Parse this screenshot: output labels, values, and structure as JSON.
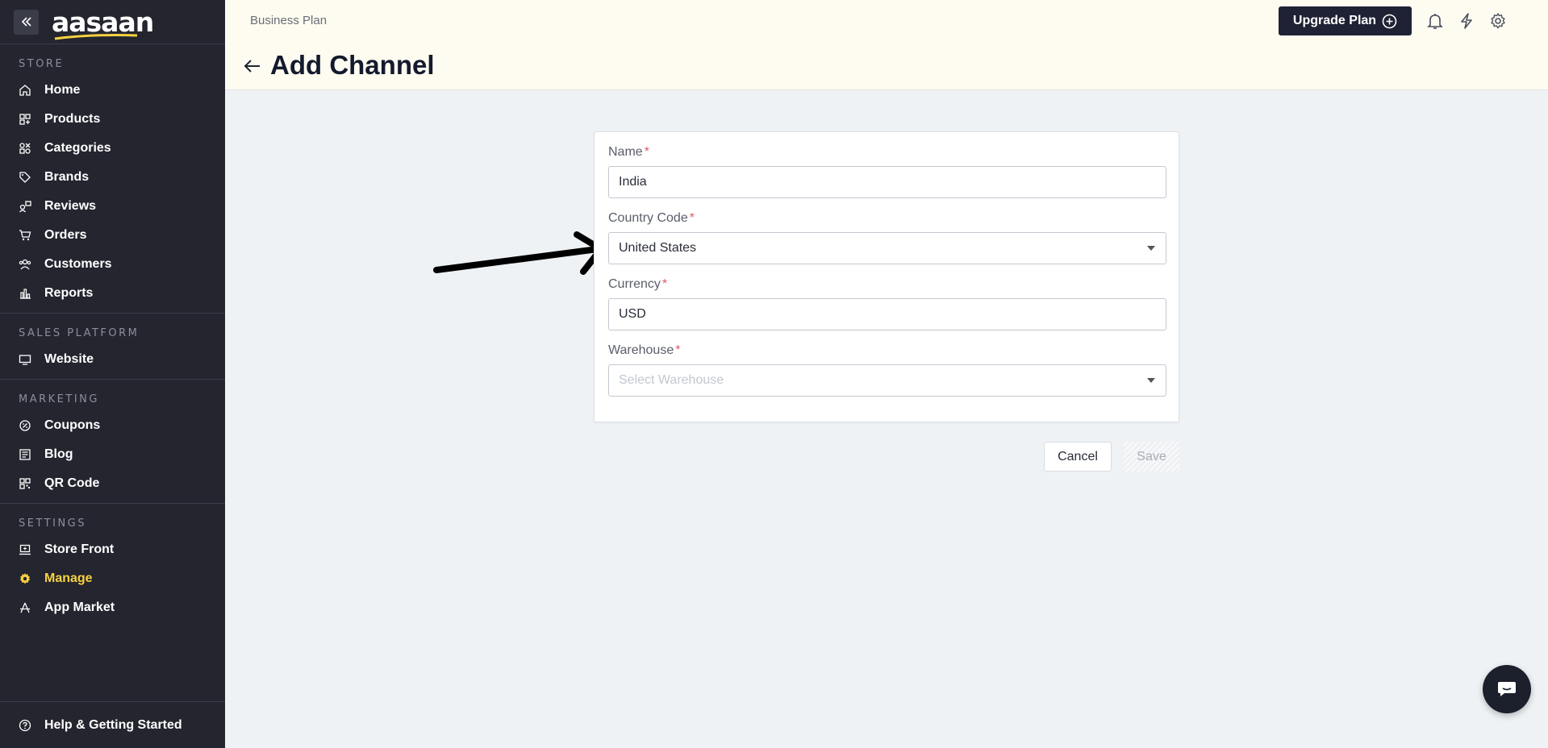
{
  "sidebar": {
    "logo": "aasaan",
    "sections": [
      {
        "heading": "STORE",
        "items": [
          {
            "label": "Home",
            "icon": "home-icon"
          },
          {
            "label": "Products",
            "icon": "products-icon"
          },
          {
            "label": "Categories",
            "icon": "categories-icon"
          },
          {
            "label": "Brands",
            "icon": "tag-icon"
          },
          {
            "label": "Reviews",
            "icon": "reviews-icon"
          },
          {
            "label": "Orders",
            "icon": "cart-icon"
          },
          {
            "label": "Customers",
            "icon": "users-icon"
          },
          {
            "label": "Reports",
            "icon": "bar-chart-icon"
          }
        ]
      },
      {
        "heading": "SALES PLATFORM",
        "items": [
          {
            "label": "Website",
            "icon": "monitor-icon"
          }
        ]
      },
      {
        "heading": "MARKETING",
        "items": [
          {
            "label": "Coupons",
            "icon": "coupon-icon"
          },
          {
            "label": "Blog",
            "icon": "blog-icon"
          },
          {
            "label": "QR Code",
            "icon": "qr-code-icon"
          }
        ]
      },
      {
        "heading": "SETTINGS",
        "items": [
          {
            "label": "Store Front",
            "icon": "storefront-icon"
          },
          {
            "label": "Manage",
            "icon": "gear-icon",
            "active": true
          },
          {
            "label": "App Market",
            "icon": "app-market-icon"
          }
        ]
      }
    ],
    "help_label": "Help & Getting Started"
  },
  "header": {
    "plan": "Business Plan",
    "title": "Add Channel",
    "upgrade_label": "Upgrade Plan"
  },
  "form": {
    "name_label": "Name",
    "name_value": "India",
    "country_label": "Country Code",
    "country_value": "United States",
    "currency_label": "Currency",
    "currency_value": "USD",
    "warehouse_label": "Warehouse",
    "warehouse_placeholder": "Select Warehouse",
    "required_mark": "*"
  },
  "actions": {
    "cancel_label": "Cancel",
    "save_label": "Save"
  },
  "colors": {
    "sidebar_bg": "#24252f",
    "accent_active": "#f7d23f",
    "header_bg": "#fefcf0",
    "page_bg": "#eff2f5"
  }
}
